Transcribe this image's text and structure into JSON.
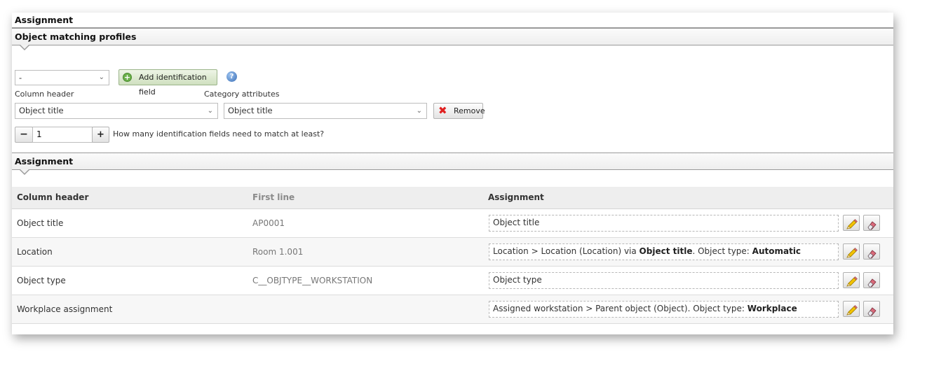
{
  "header": {
    "title": "Assignment"
  },
  "profiles": {
    "title": "Object matching profiles",
    "profile_select_value": "-",
    "add_button_label": "Add identification field",
    "column_header_label": "Column header",
    "category_attributes_label": "Category attributes",
    "column_header_value": "Object title",
    "category_attribute_value": "Object title",
    "remove_label": "Remove",
    "min_match_value": "1",
    "min_match_label": "How many identification fields need to match at least?"
  },
  "assignment": {
    "title": "Assignment",
    "columns": [
      "Column header",
      "First line",
      "Assignment"
    ],
    "rows": [
      {
        "header": "Object title",
        "first_line": "AP0001",
        "assignment_parts": [
          [
            "Object title",
            false
          ]
        ]
      },
      {
        "header": "Location",
        "first_line": "Room 1.001",
        "assignment_parts": [
          [
            "Location > Location (Location) via ",
            false
          ],
          [
            "Object title",
            true
          ],
          [
            ". Object type: ",
            false
          ],
          [
            "Automatic",
            true
          ]
        ]
      },
      {
        "header": "Object type",
        "first_line": "C__OBJTYPE__WORKSTATION",
        "assignment_parts": [
          [
            "Object type",
            false
          ]
        ]
      },
      {
        "header": "Workplace assignment",
        "first_line": "",
        "assignment_parts": [
          [
            "Assigned workstation > Parent object (Object). Object type: ",
            false
          ],
          [
            "Workplace",
            true
          ]
        ]
      }
    ]
  },
  "colors": {
    "add_button_bg": "#d9e8cc",
    "remove_icon": "#e02020",
    "help_icon": "#3b6fb6",
    "edit_icon": "#e8b800"
  }
}
